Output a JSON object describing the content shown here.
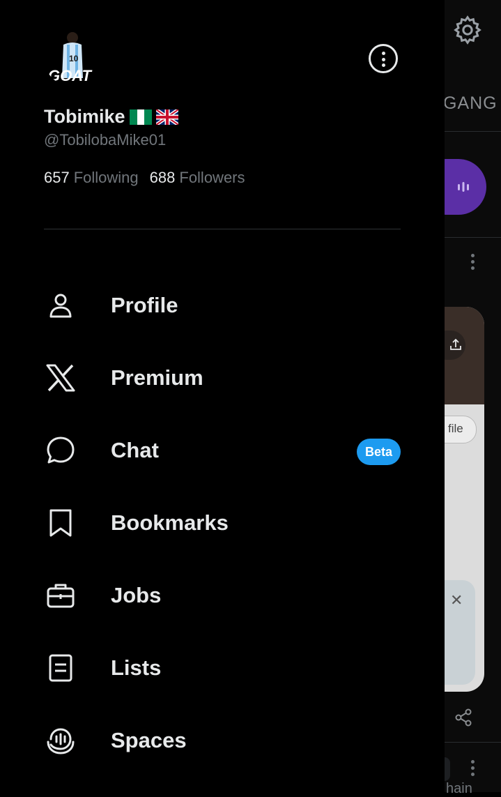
{
  "profile": {
    "display_name": "Tobimike",
    "handle": "@TobilobaMike01",
    "following_count": "657",
    "following_label": "Following",
    "followers_count": "688",
    "followers_label": "Followers"
  },
  "menu": [
    {
      "label": "Profile",
      "icon": "person-icon"
    },
    {
      "label": "Premium",
      "icon": "x-logo-icon"
    },
    {
      "label": "Chat",
      "icon": "chat-bubble-icon",
      "badge": "Beta"
    },
    {
      "label": "Bookmarks",
      "icon": "bookmark-icon"
    },
    {
      "label": "Jobs",
      "icon": "briefcase-icon"
    },
    {
      "label": "Lists",
      "icon": "list-icon"
    },
    {
      "label": "Spaces",
      "icon": "spaces-icon"
    }
  ],
  "background": {
    "tab_fragment": "GANG",
    "chip_fragment": "file",
    "bottom_fragment": "hain"
  },
  "colors": {
    "accent": "#1d9bf0",
    "text": "#e7e9ea",
    "muted": "#71767b",
    "spaces_pill": "#5b2fa6"
  }
}
